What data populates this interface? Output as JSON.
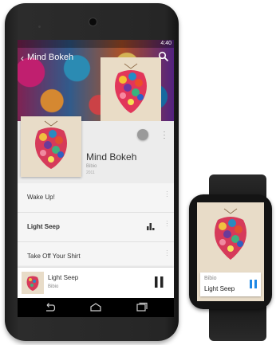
{
  "status_bar": {
    "time": "4:40"
  },
  "header": {
    "back_title": "Mind Bokeh"
  },
  "album": {
    "title": "Mind Bokeh",
    "artist": "Bibio",
    "year": "2011"
  },
  "tracks": [
    {
      "label": "Wake Up!"
    },
    {
      "label": "Light Seep"
    },
    {
      "label": "Take Off Your Shirt"
    }
  ],
  "now_playing": {
    "title": "Light Seep",
    "artist": "Bibio"
  },
  "watch": {
    "artist": "Bibio",
    "title": "Light Seep"
  },
  "colors": {
    "accent": "#1e88e5",
    "background": "#ececec"
  },
  "icons": [
    "back-chevron-icon",
    "search-icon",
    "pin-icon",
    "overflow-menu-icon",
    "equalizer-icon",
    "pause-icon",
    "nav-back-icon",
    "nav-home-icon",
    "nav-recents-icon"
  ]
}
